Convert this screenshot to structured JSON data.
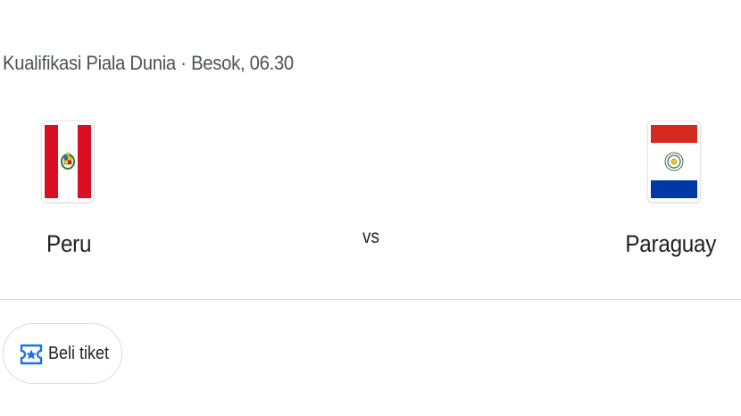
{
  "match": {
    "header": "Kualifikasi Piala Dunia · Besok, 06.30",
    "vs_label": "vs"
  },
  "home_team": {
    "name": "Peru",
    "flag_icon": "peru-flag-icon",
    "flag_colors": {
      "red": "#d91023",
      "white": "#ffffff"
    }
  },
  "away_team": {
    "name": "Paraguay",
    "flag_icon": "paraguay-flag-icon",
    "flag_colors": {
      "red": "#d52b1e",
      "white": "#ffffff",
      "blue": "#0038a8"
    }
  },
  "tickets": {
    "label": "Beli tiket",
    "icon": "ticket-icon",
    "icon_color": "#1a73e8"
  }
}
